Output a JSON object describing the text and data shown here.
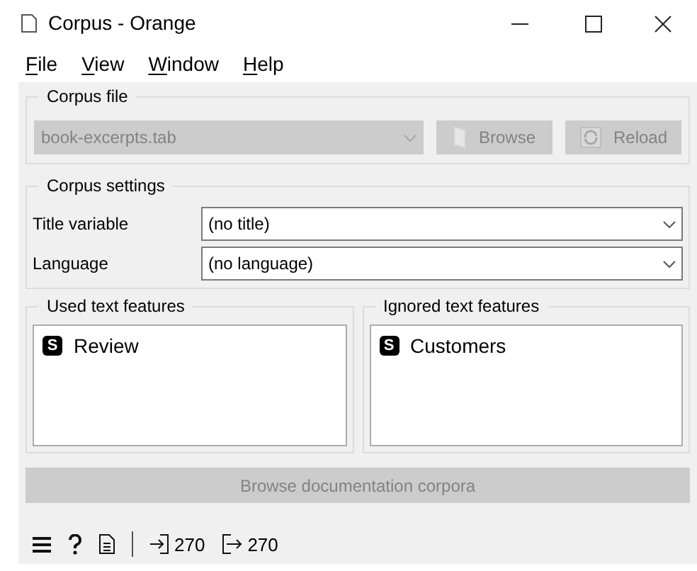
{
  "window": {
    "title": "Corpus - Orange"
  },
  "menu": [
    "File",
    "View",
    "Window",
    "Help"
  ],
  "corpus_file": {
    "title": "Corpus file",
    "file": {
      "value": "book-excerpts.tab",
      "disabled": true
    },
    "buttons": [
      {
        "label": "Browse",
        "kind": "browse",
        "disabled": true
      },
      {
        "label": "Reload",
        "kind": "reload",
        "disabled": true
      }
    ]
  },
  "corpus_settings": {
    "title": "Corpus settings",
    "fields": [
      {
        "label": "Title variable",
        "value": "(no title)"
      },
      {
        "label": "Language",
        "value": "(no language)"
      }
    ]
  },
  "feature_lists": [
    {
      "title": "Used text features",
      "items": [
        {
          "badge": "S",
          "label": "Review"
        }
      ]
    },
    {
      "title": "Ignored text features",
      "items": [
        {
          "badge": "S",
          "label": "Customers"
        }
      ]
    }
  ],
  "documentation_button": {
    "label": "Browse documentation corpora",
    "disabled": true
  },
  "status_bar": {
    "input_count": "270",
    "output_count": "270"
  }
}
